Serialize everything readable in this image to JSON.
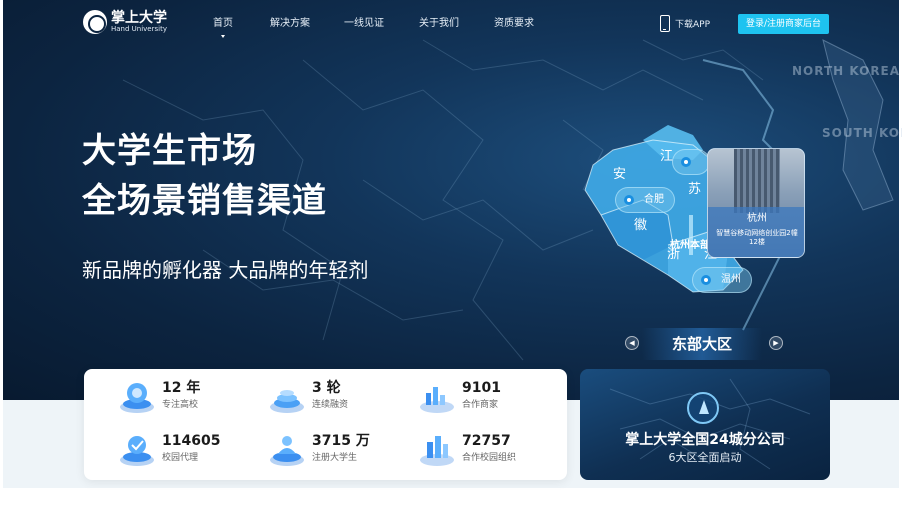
{
  "brand": {
    "name_cn": "掌上大学",
    "name_en": "Hand University"
  },
  "nav": {
    "items": [
      {
        "label": "首页",
        "active": true
      },
      {
        "label": "解决方案"
      },
      {
        "label": "一线见证"
      },
      {
        "label": "关于我们"
      },
      {
        "label": "资质要求"
      }
    ],
    "download_label": "下载APP",
    "login_label": "登录/注册商家后台"
  },
  "hero": {
    "headline_line1": "大学生市场",
    "headline_line2": "全场景销售渠道",
    "slogan": "新品牌的孵化器 大品牌的年轻剂"
  },
  "map": {
    "countries": [
      "NORTH KOREA",
      "SOUTH KOREA"
    ],
    "provinces": [
      "江",
      "苏",
      "安",
      "徽",
      "浙",
      "江"
    ],
    "pins": [
      {
        "label": ""
      },
      {
        "label": "合肥"
      },
      {
        "label": "温州"
      }
    ],
    "hq_label": "杭州本部",
    "office_card": {
      "city": "杭州",
      "address": "智慧谷移动网络创业园2幢12楼"
    },
    "region_name": "东部大区"
  },
  "stats": [
    {
      "value": "12 年",
      "label": "专注高校",
      "icon": "campus-icon"
    },
    {
      "value": "3 轮",
      "label": "连续融资",
      "icon": "funding-icon"
    },
    {
      "value": "9101",
      "label": "合作商家",
      "icon": "merchant-icon"
    },
    {
      "value": "114605",
      "label": "校园代理",
      "icon": "agent-icon"
    },
    {
      "value": "3715 万",
      "label": "注册大学生",
      "icon": "student-icon"
    },
    {
      "value": "72757",
      "label": "合作校园组织",
      "icon": "organization-icon"
    }
  ],
  "branch": {
    "title": "掌上大学全国24城分公司",
    "subtitle": "6大区全面启动"
  },
  "colors": {
    "accent": "#1ec3f0",
    "hero_bg": "#0c2440",
    "province": "#3fa9e6"
  }
}
